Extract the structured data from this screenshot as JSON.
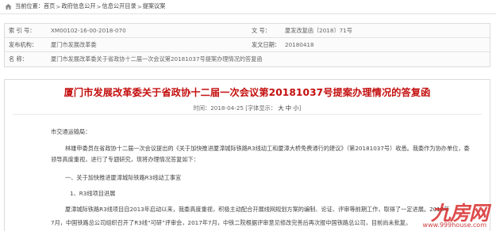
{
  "breadcrumb": {
    "prefix": "当前位置：",
    "items": [
      "首页",
      "政府信息公开",
      "信息公开目录",
      "提案议案"
    ],
    "separator": ">"
  },
  "meta": {
    "index_label": "索 引 号：",
    "index_value": "XM00102-16-00-2018-070",
    "docno_label": "文    号：",
    "docno_value": "厦发改复函〔2018〕71号",
    "org_label": "发布机构：",
    "org_value": "厦门市发展改革委",
    "date_label": "发文日期：",
    "date_value": "20180418",
    "name_label": "名    称：",
    "name_value": "厦门市发展改革委关于省政协十二届一次会议第20181037号提案办理情况的答复函"
  },
  "article": {
    "title": "厦门市发展改革委关于省政协十二届一次会议第20181037号提案办理情况的答复函",
    "date_prefix": "时间：",
    "date": "2018-04-25",
    "font_label": "[字体显示：",
    "font_sizes": [
      "大",
      "中",
      "小"
    ],
    "font_close": "]",
    "paragraphs": [
      "市交通运输局：",
      "林雄申委员在省政协十二届一次会议提出的《关于加快推进厦漳城际铁路R3线动工和厦漳大桥免费通行的建议》（第20181037号）收悉。我委作为协办单位，委",
      "领导高度重视，进行了专题研究，现将办理情况答复如下：",
      "一、关于加快推进厦漳城际铁路R3线动工事宜",
      "1、R3线项目进展",
      "厦漳城际铁路R3线项目自2013年启动以来，我委高度重视，积极主动配合开展线网规划方案的编制、论证、评审等前期工作，取得了一定进展。2016年",
      "7月，中国铁路总公司组织召开了R3线“可研”评审会，2017年7月，中铁二院根据评审意见修改完善后再次报中国铁路总公司，目前尚未批复。",
      "..."
    ]
  },
  "watermark": {
    "brand": "九房网",
    "url": "www.999house.com"
  },
  "colors": {
    "title_red": "#c40e0e",
    "border": "#dcdcdc",
    "watermark_red": "#d52323"
  }
}
